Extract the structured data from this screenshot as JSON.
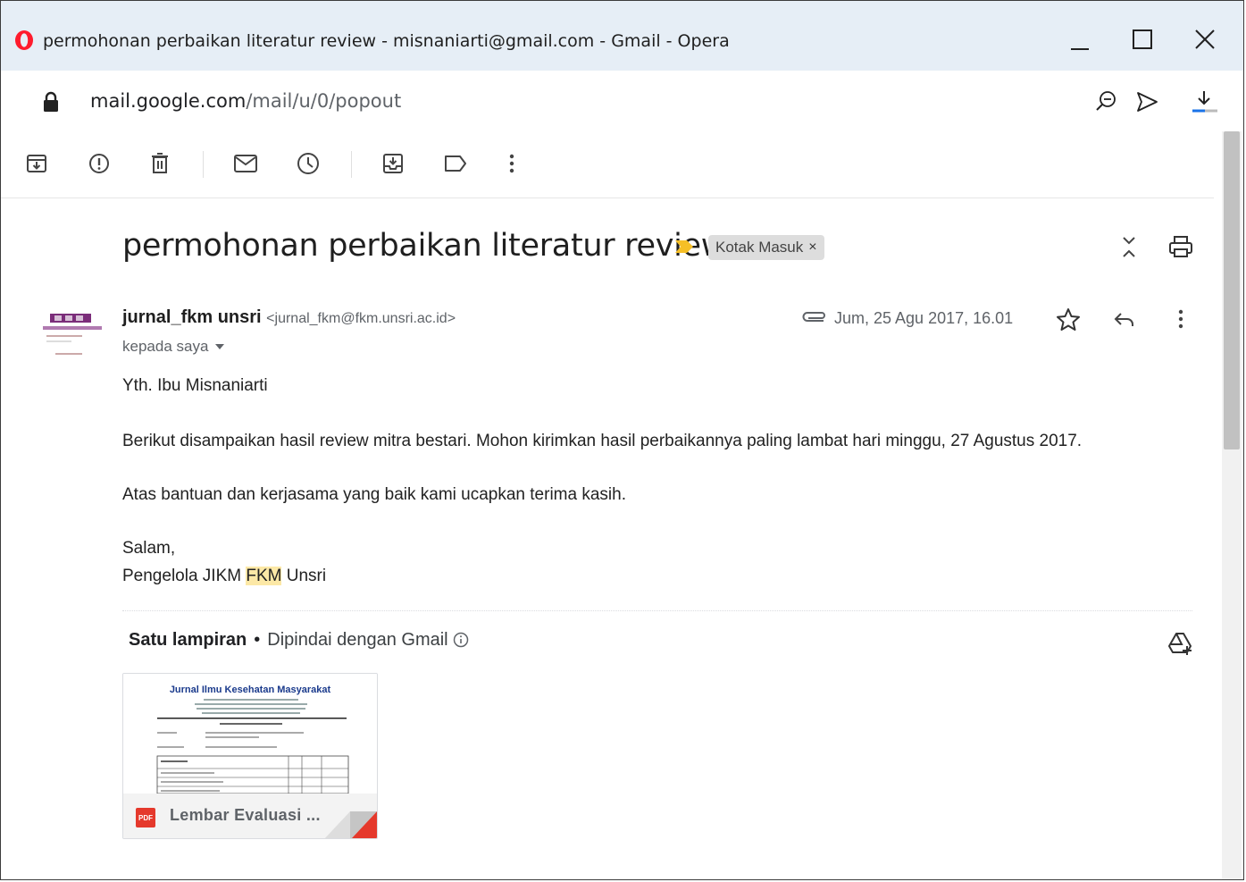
{
  "window": {
    "title": "permohonan perbaikan literatur review - misnaniarti@gmail.com - Gmail - Opera",
    "url_host": "mail.google.com",
    "url_path": "/mail/u/0/popout"
  },
  "toolbar": {
    "icons": [
      "archive-icon",
      "report-spam-icon",
      "delete-icon",
      "mark-unread-icon",
      "snooze-icon",
      "move-to-icon",
      "label-icon",
      "more-vert-icon"
    ]
  },
  "email": {
    "subject": "permohonan perbaikan literatur review",
    "label": "Kotak Masuk",
    "label_close": "×",
    "sender_name": "jurnal_fkm unsri",
    "sender_email": "<jurnal_fkm@fkm.unsri.ac.id>",
    "to": "kepada saya",
    "date": "Jum, 25 Agu 2017, 16.01",
    "greeting": "Yth. Ibu Misnaniarti",
    "para1": "Berikut disampaikan hasil review mitra bestari. Mohon kirimkan hasil perbaikannya paling lambat hari minggu, 27 Agustus 2017.",
    "para2": "Atas bantuan dan kerjasama yang baik kami ucapkan terima kasih.",
    "closing": "Salam,",
    "sig_pre": "Pengelola JIKM ",
    "sig_highlight": "FKM",
    "sig_post": " Unsri"
  },
  "attachments": {
    "header_bold": "Satu lampiran",
    "separator": "•",
    "scanned": "Dipindai dengan Gmail",
    "file_name": "Lembar Evaluasi ...",
    "file_type": "PDF",
    "thumb_title": "Jurnal Ilmu Kesehatan Masyarakat"
  },
  "colors": {
    "titlebar": "#e6eef6",
    "opera_red": "#ff1b2d",
    "importance": "#f6bf26",
    "highlight": "#fce8a6",
    "pdf_red": "#e5392c"
  }
}
